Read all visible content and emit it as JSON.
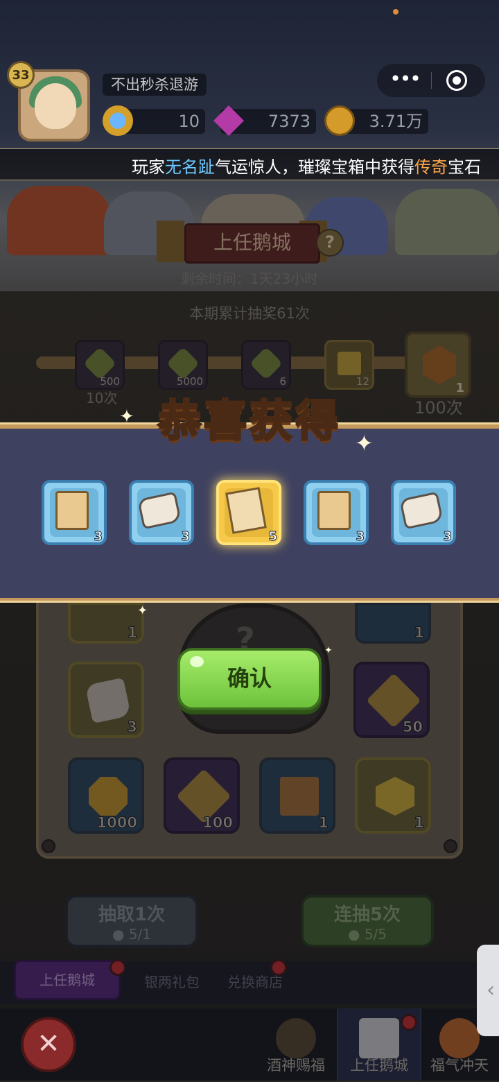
{
  "header": {
    "level": "33",
    "player_name": "不出秒杀退游",
    "currencies": [
      {
        "icon": "blue-orb-icon",
        "value": "10"
      },
      {
        "icon": "purple-gem-icon",
        "value": "7373"
      },
      {
        "icon": "gold-coin-icon",
        "value": "3.71万"
      }
    ]
  },
  "ticker": {
    "prefix": "玩家",
    "player": "无名趾",
    "middle": "气运惊人，璀璨宝箱中获得",
    "rarity": "传奇",
    "suffix": "宝石"
  },
  "event": {
    "title": "上任鹅城",
    "help": "?",
    "remaining": "剩余时间：1天23小时",
    "total_draws": "本期累计抽奖61次"
  },
  "milestones": [
    {
      "count": "500",
      "label": "10次"
    },
    {
      "count": "5000",
      "label": ""
    },
    {
      "count": "6",
      "label": ""
    },
    {
      "count": "12",
      "label": ""
    }
  ],
  "big_milestone": {
    "count": "1",
    "label": "100次"
  },
  "popup": {
    "title": "恭喜获得",
    "rewards": [
      {
        "type": "scroll",
        "count": "3"
      },
      {
        "type": "stone",
        "count": "3"
      },
      {
        "type": "paper",
        "count": "5"
      },
      {
        "type": "scroll",
        "count": "3"
      },
      {
        "type": "stone",
        "count": "3"
      }
    ],
    "confirm": "确认"
  },
  "board": {
    "partial_counts": [
      "1",
      "1"
    ],
    "cells": [
      {
        "count": "3"
      },
      {
        "count": "50"
      },
      {
        "count": "1000"
      },
      {
        "count": "100"
      },
      {
        "count": "1"
      },
      {
        "count": "1"
      }
    ],
    "center": "?"
  },
  "draw_buttons": [
    {
      "label": "抽取1次",
      "cost": "5/1"
    },
    {
      "label": "连抽5次",
      "cost": "5/5"
    }
  ],
  "tabs": [
    "上任鹅城",
    "银两礼包",
    "兑换商店"
  ],
  "bottom_nav": [
    "酒神赐福",
    "上任鹅城",
    "福气冲天"
  ],
  "close": "✕",
  "side_tab": "‹"
}
